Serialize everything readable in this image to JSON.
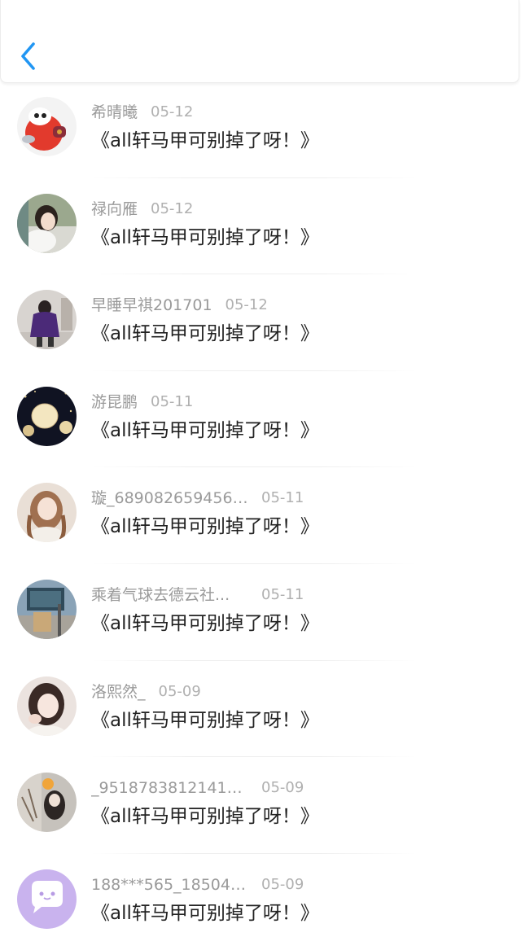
{
  "header": {
    "back_icon": "chevron-left-icon",
    "accent_color": "#2196f3"
  },
  "comments": [
    {
      "user": "希晴曦",
      "date": "05-12",
      "text": "《all轩马甲可别掉了呀！》",
      "avatar": "red-robot-avatar"
    },
    {
      "user": "禄向雁",
      "date": "05-12",
      "text": "《all轩马甲可别掉了呀！》",
      "avatar": "girl-photo-avatar"
    },
    {
      "user": "早睡早祺201701",
      "date": "05-12",
      "text": "《all轩马甲可别掉了呀！》",
      "avatar": "purple-coat-avatar"
    },
    {
      "user": "游昆鹏",
      "date": "05-11",
      "text": "《all轩马甲可别掉了呀！》",
      "avatar": "lanterns-avatar"
    },
    {
      "user": "璇_6890826594568...",
      "date": "05-11",
      "text": "《all轩马甲可别掉了呀！》",
      "avatar": "girl-portrait-avatar"
    },
    {
      "user": "乘着气球去德云社...",
      "date": "05-11",
      "text": "《all轩马甲可别掉了呀！》",
      "avatar": "street-sign-avatar"
    },
    {
      "user": "洛熙然_",
      "date": "05-09",
      "text": "《all轩马甲可别掉了呀！》",
      "avatar": "girl-smile-avatar"
    },
    {
      "user": "_95187838121415...",
      "date": "05-09",
      "text": "《all轩马甲可别掉了呀！》",
      "avatar": "flower-girl-avatar"
    },
    {
      "user": "188***565_185040...",
      "date": "05-09",
      "text": "《all轩马甲可别掉了呀！》",
      "avatar": "chat-bubble-avatar"
    }
  ]
}
